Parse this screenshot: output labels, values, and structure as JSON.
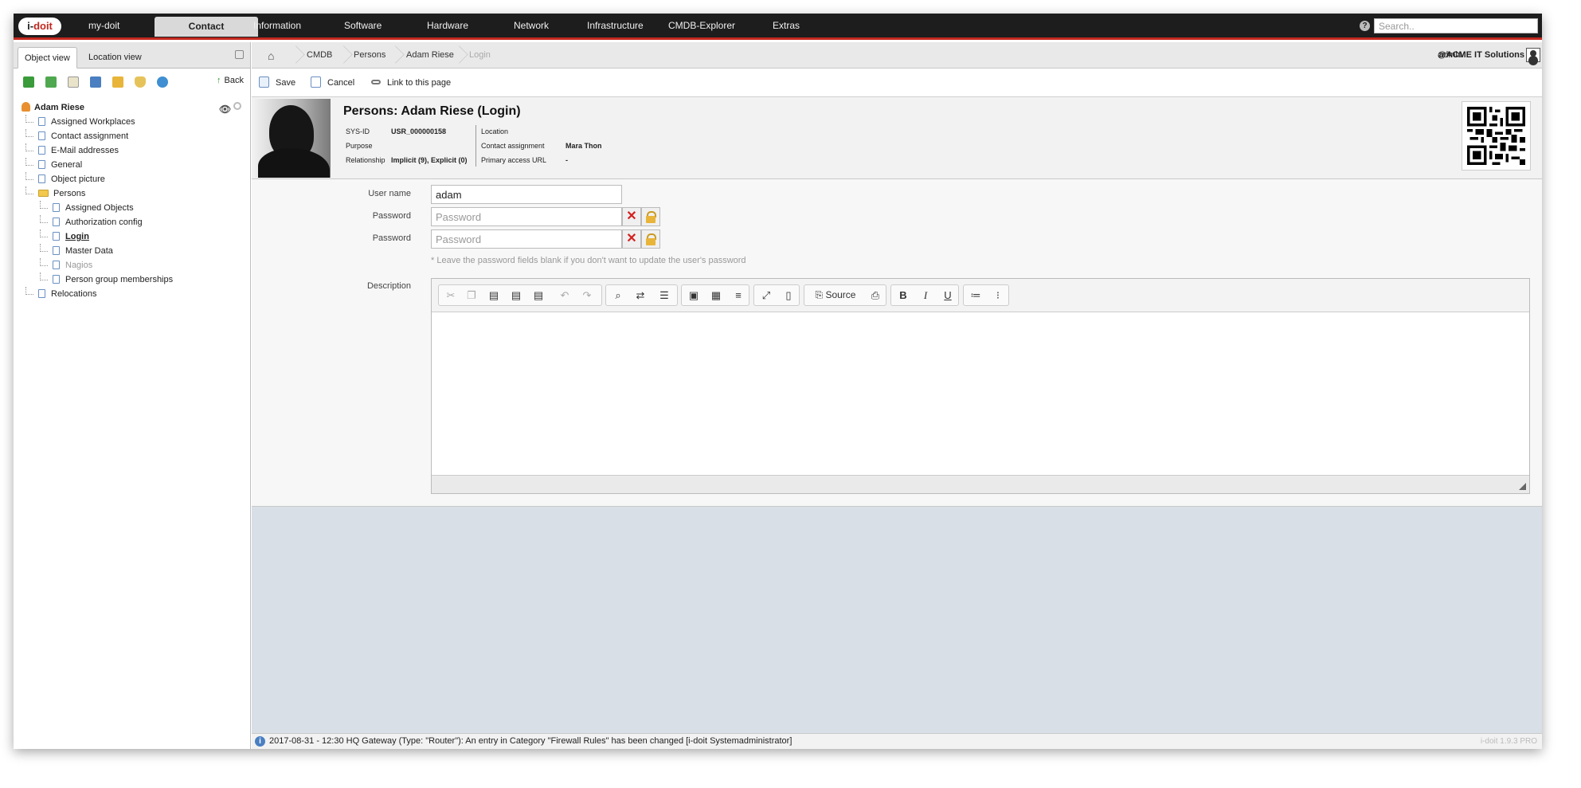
{
  "topnav": {
    "logo_text_1": "i-",
    "logo_text_2": "doit",
    "items": [
      "my-doit",
      "Contact",
      "Information",
      "Software",
      "Hardware",
      "Network",
      "Infrastructure",
      "CMDB-Explorer",
      "Extras"
    ],
    "active": "Contact",
    "search_placeholder": "Search..",
    "help_icon": "question-icon"
  },
  "leftpanel": {
    "tabs": [
      "Object view",
      "Location view"
    ],
    "active_tab": "Object view",
    "toolbar_icons": [
      "tree-icon",
      "expand-icon",
      "list-icon",
      "book-icon",
      "lock-icon",
      "shield-icon",
      "globe-icon"
    ],
    "back_label": "Back",
    "root": "Adam Riese",
    "tree": [
      {
        "label": "Assigned Workplaces",
        "level": 1
      },
      {
        "label": "Contact assignment",
        "level": 1
      },
      {
        "label": "E-Mail addresses",
        "level": 1
      },
      {
        "label": "General",
        "level": 1
      },
      {
        "label": "Object picture",
        "level": 1
      },
      {
        "label": "Persons",
        "level": 1,
        "folder": true
      },
      {
        "label": "Assigned Objects",
        "level": 2
      },
      {
        "label": "Authorization config",
        "level": 2
      },
      {
        "label": "Login",
        "level": 2,
        "selected": true
      },
      {
        "label": "Master Data",
        "level": 2
      },
      {
        "label": "Nagios",
        "level": 2,
        "dim": true
      },
      {
        "label": "Person group memberships",
        "level": 2
      },
      {
        "label": "Relocations",
        "level": 1
      }
    ]
  },
  "breadcrumb": {
    "items": [
      "CMDB",
      "Persons",
      "Adam Riese",
      "Login"
    ],
    "user": "admin",
    "tenant": "@ACME IT Solutions"
  },
  "actions": {
    "save": "Save",
    "cancel": "Cancel",
    "link": "Link to this page"
  },
  "object": {
    "title": "Persons: Adam Riese (Login)",
    "sysid_label": "SYS-ID",
    "sysid_value": "USR_000000158",
    "purpose_label": "Purpose",
    "relationship_label": "Relationship",
    "relationship_value": "Implicit (9), Explicit (0)",
    "location_label": "Location",
    "contact_label": "Contact assignment",
    "contact_value": "Mara Thon",
    "url_label": "Primary access URL",
    "url_value": "-"
  },
  "form": {
    "username_label": "User name",
    "username_value": "adam",
    "password_label": "Password",
    "password_placeholder": "Password",
    "password2_label": "Password",
    "password2_placeholder": "Password",
    "hint": "* Leave the password fields blank if you don't want to update the user's password",
    "description_label": "Description",
    "source_label": "Source"
  },
  "status": {
    "message": "2017-08-31 - 12:30 HQ Gateway (Type: \"Router\"): An entry in Category \"Firewall Rules\" has been changed [i-doit Systemadministrator]",
    "version": "i-doit 1.9.3 PRO"
  }
}
